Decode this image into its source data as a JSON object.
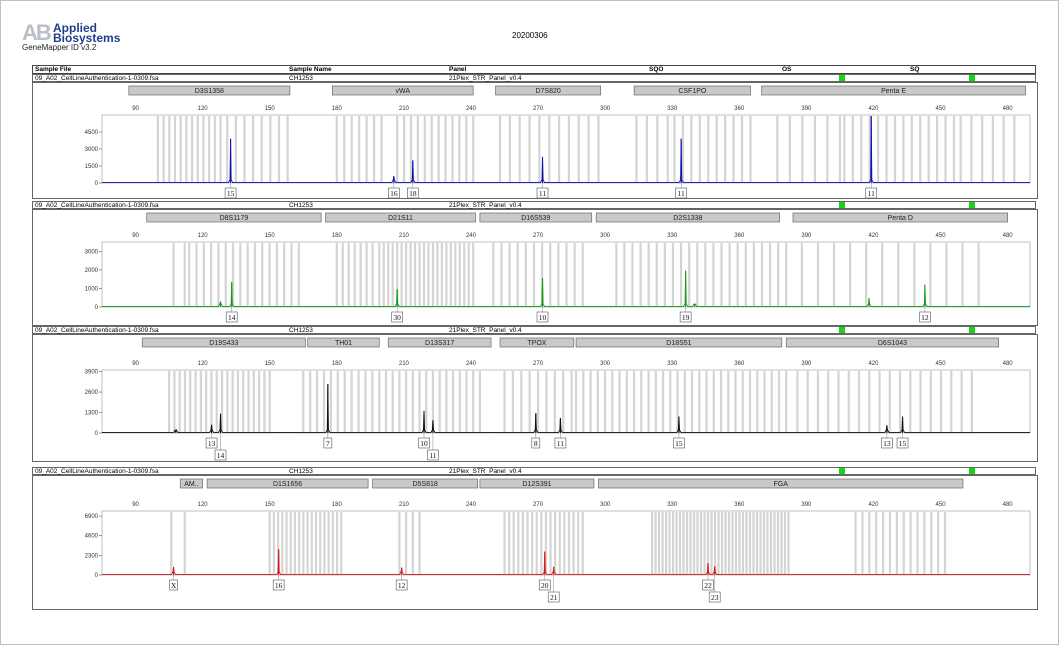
{
  "header": {
    "logo_text": "AB",
    "logo_line1": "Applied",
    "logo_line2": "Biosystems",
    "software": "GeneMapper ID v3.2",
    "run_date": "20200306"
  },
  "table_header": {
    "sample_file": "Sample File",
    "sample_name": "Sample Name",
    "panel": "Panel",
    "sqo": "SQO",
    "os": "OS",
    "sq": "SQ"
  },
  "quality_color": "#19d319",
  "chart_data": [
    {
      "type": "line",
      "dye": "blue",
      "color": "#1010b0",
      "sample_file": "09_A02_CellLineAuthentication-1-0309.fsa",
      "sample_name": "CH1253",
      "panel": "21Plex_STR_Panel_v0.4",
      "xlim": [
        75,
        490
      ],
      "x_ticks": [
        90,
        120,
        150,
        180,
        210,
        240,
        270,
        300,
        330,
        360,
        390,
        420,
        450,
        480
      ],
      "ylim": [
        0,
        6000
      ],
      "y_ticks": [
        0,
        1500,
        3000,
        4500
      ],
      "markers": [
        {
          "name": "D3S1358",
          "start": 87,
          "end": 159
        },
        {
          "name": "vWA",
          "start": 178,
          "end": 241
        },
        {
          "name": "D7S820",
          "start": 251,
          "end": 298
        },
        {
          "name": "CSF1PO",
          "start": 313,
          "end": 365
        },
        {
          "name": "Penta E",
          "start": 370,
          "end": 488
        }
      ],
      "bins": [
        {
          "start": 100,
          "end": 128,
          "n": 12
        },
        {
          "start": 131,
          "end": 158,
          "n": 8
        },
        {
          "start": 180,
          "end": 200,
          "n": 7
        },
        {
          "start": 207,
          "end": 241,
          "n": 12
        },
        {
          "start": 253,
          "end": 297,
          "n": 11
        },
        {
          "start": 314,
          "end": 328,
          "n": 4
        },
        {
          "start": 331,
          "end": 365,
          "n": 10
        },
        {
          "start": 377,
          "end": 405,
          "n": 6
        },
        {
          "start": 407,
          "end": 456,
          "n": 14
        },
        {
          "start": 459,
          "end": 483,
          "n": 6
        }
      ],
      "peaks": [
        {
          "x": 132.5,
          "h": 3900
        },
        {
          "x": 205.5,
          "h": 600
        },
        {
          "x": 214,
          "h": 2000
        },
        {
          "x": 272,
          "h": 2300
        },
        {
          "x": 334,
          "h": 3900
        },
        {
          "x": 419,
          "h": 5900
        }
      ],
      "alleles": [
        {
          "x": 132.5,
          "label": "15",
          "row": 0
        },
        {
          "x": 205.5,
          "label": "16",
          "row": 0
        },
        {
          "x": 214,
          "label": "18",
          "row": 0
        },
        {
          "x": 272,
          "label": "11",
          "row": 0
        },
        {
          "x": 334,
          "label": "11",
          "row": 0
        },
        {
          "x": 419,
          "label": "11",
          "row": 0
        }
      ]
    },
    {
      "type": "line",
      "dye": "green",
      "color": "#159a15",
      "sample_file": "09_A02_CellLineAuthentication-1-0309.fsa",
      "sample_name": "CH1253",
      "panel": "21Plex_STR_Panel_v0.4",
      "xlim": [
        75,
        490
      ],
      "x_ticks": [
        90,
        120,
        150,
        180,
        210,
        240,
        270,
        300,
        330,
        360,
        390,
        420,
        450,
        480
      ],
      "ylim": [
        0,
        3500
      ],
      "y_ticks": [
        0,
        1000,
        2000,
        3000
      ],
      "markers": [
        {
          "name": "D8S1179",
          "start": 95,
          "end": 173
        },
        {
          "name": "D21S11",
          "start": 175,
          "end": 242
        },
        {
          "name": "D16S539",
          "start": 244,
          "end": 294
        },
        {
          "name": "D2S1338",
          "start": 296,
          "end": 378
        },
        {
          "name": "Penta D",
          "start": 384,
          "end": 480
        }
      ],
      "bins": [
        {
          "start": 107,
          "end": 112,
          "n": 2
        },
        {
          "start": 114,
          "end": 163,
          "n": 16
        },
        {
          "start": 180,
          "end": 196,
          "n": 7
        },
        {
          "start": 199,
          "end": 241,
          "n": 22
        },
        {
          "start": 250,
          "end": 290,
          "n": 12
        },
        {
          "start": 305,
          "end": 381,
          "n": 22
        },
        {
          "start": 388,
          "end": 467,
          "n": 12
        }
      ],
      "peaks": [
        {
          "x": 128,
          "h": 300
        },
        {
          "x": 133,
          "h": 1350
        },
        {
          "x": 207,
          "h": 950
        },
        {
          "x": 272,
          "h": 1550
        },
        {
          "x": 336,
          "h": 1950
        },
        {
          "x": 340,
          "h": 150
        },
        {
          "x": 418,
          "h": 480
        },
        {
          "x": 443,
          "h": 1200
        }
      ],
      "alleles": [
        {
          "x": 133,
          "label": "14",
          "row": 0
        },
        {
          "x": 207,
          "label": "30",
          "row": 0
        },
        {
          "x": 272,
          "label": "10",
          "row": 0
        },
        {
          "x": 336,
          "label": "19",
          "row": 0
        },
        {
          "x": 443,
          "label": "12",
          "row": 0
        }
      ]
    },
    {
      "type": "line",
      "dye": "black",
      "color": "#111111",
      "sample_file": "09_A02_CellLineAuthentication-1-0309.fsa",
      "sample_name": "CH1253",
      "panel": "21Plex_STR_Panel_v0.4",
      "xlim": [
        75,
        490
      ],
      "x_ticks": [
        90,
        120,
        150,
        180,
        210,
        240,
        270,
        300,
        330,
        360,
        390,
        420,
        450,
        480
      ],
      "ylim": [
        0,
        4000
      ],
      "y_ticks": [
        0,
        1300,
        2600,
        3900
      ],
      "markers": [
        {
          "name": "D19S433",
          "start": 93,
          "end": 166
        },
        {
          "name": "TH01",
          "start": 167,
          "end": 199
        },
        {
          "name": "D13S317",
          "start": 203,
          "end": 249
        },
        {
          "name": "TPOX",
          "start": 253,
          "end": 286
        },
        {
          "name": "D18S51",
          "start": 287,
          "end": 379
        },
        {
          "name": "D6S1043",
          "start": 381,
          "end": 476
        }
      ],
      "bins": [
        {
          "start": 105,
          "end": 150,
          "n": 20
        },
        {
          "start": 165,
          "end": 199,
          "n": 12
        },
        {
          "start": 202,
          "end": 244,
          "n": 15
        },
        {
          "start": 255,
          "end": 285,
          "n": 9
        },
        {
          "start": 287,
          "end": 381,
          "n": 30
        },
        {
          "start": 386,
          "end": 464,
          "n": 18
        }
      ],
      "peaks": [
        {
          "x": 108,
          "h": 60
        },
        {
          "x": 124,
          "h": 520
        },
        {
          "x": 128,
          "h": 1230
        },
        {
          "x": 176,
          "h": 3100
        },
        {
          "x": 219,
          "h": 1400
        },
        {
          "x": 223,
          "h": 800
        },
        {
          "x": 269,
          "h": 1250
        },
        {
          "x": 280,
          "h": 950
        },
        {
          "x": 333,
          "h": 1050
        },
        {
          "x": 426,
          "h": 490
        },
        {
          "x": 433,
          "h": 1050
        }
      ],
      "alleles": [
        {
          "x": 124,
          "label": "13",
          "row": 0
        },
        {
          "x": 128,
          "label": "14",
          "row": 1
        },
        {
          "x": 176,
          "label": "7",
          "row": 0
        },
        {
          "x": 219,
          "label": "10",
          "row": 0
        },
        {
          "x": 223,
          "label": "11",
          "row": 1
        },
        {
          "x": 269,
          "label": "8",
          "row": 0
        },
        {
          "x": 280,
          "label": "11",
          "row": 0
        },
        {
          "x": 333,
          "label": "15",
          "row": 0
        },
        {
          "x": 426,
          "label": "13",
          "row": 0
        },
        {
          "x": 433,
          "label": "15",
          "row": 0
        }
      ]
    },
    {
      "type": "line",
      "dye": "red",
      "color": "#d81818",
      "sample_file": "09_A02_CellLineAuthentication-1-0309.fsa",
      "sample_name": "CH1253",
      "panel": "21Plex_STR_Panel_v0.4",
      "xlim": [
        75,
        490
      ],
      "x_ticks": [
        90,
        120,
        150,
        180,
        210,
        240,
        270,
        300,
        330,
        360,
        390,
        420,
        450,
        480
      ],
      "ylim": [
        0,
        7500
      ],
      "y_ticks": [
        0,
        2300,
        4600,
        6900
      ],
      "markers": [
        {
          "name": "AM..",
          "start": 110,
          "end": 120
        },
        {
          "name": "D1S1656",
          "start": 122,
          "end": 194
        },
        {
          "name": "D5S818",
          "start": 196,
          "end": 243
        },
        {
          "name": "D12S391",
          "start": 244,
          "end": 295
        },
        {
          "name": "FGA",
          "start": 297,
          "end": 460
        }
      ],
      "bins": [
        {
          "start": 106,
          "end": 112,
          "n": 2
        },
        {
          "start": 150,
          "end": 182,
          "n": 18
        },
        {
          "start": 208,
          "end": 217,
          "n": 4
        },
        {
          "start": 255,
          "end": 290,
          "n": 18
        },
        {
          "start": 321,
          "end": 382,
          "n": 40
        },
        {
          "start": 412,
          "end": 452,
          "n": 14
        }
      ],
      "peaks": [
        {
          "x": 107,
          "h": 950
        },
        {
          "x": 154,
          "h": 3000
        },
        {
          "x": 209,
          "h": 870
        },
        {
          "x": 273,
          "h": 2750
        },
        {
          "x": 277,
          "h": 950
        },
        {
          "x": 346,
          "h": 1400
        },
        {
          "x": 349,
          "h": 1000
        }
      ],
      "alleles": [
        {
          "x": 107,
          "label": "X",
          "row": 0
        },
        {
          "x": 154,
          "label": "16",
          "row": 0
        },
        {
          "x": 209,
          "label": "12",
          "row": 0
        },
        {
          "x": 273,
          "label": "20",
          "row": 0
        },
        {
          "x": 277,
          "label": "21",
          "row": 1
        },
        {
          "x": 346,
          "label": "22",
          "row": 0
        },
        {
          "x": 349,
          "label": "23",
          "row": 1
        }
      ]
    }
  ]
}
